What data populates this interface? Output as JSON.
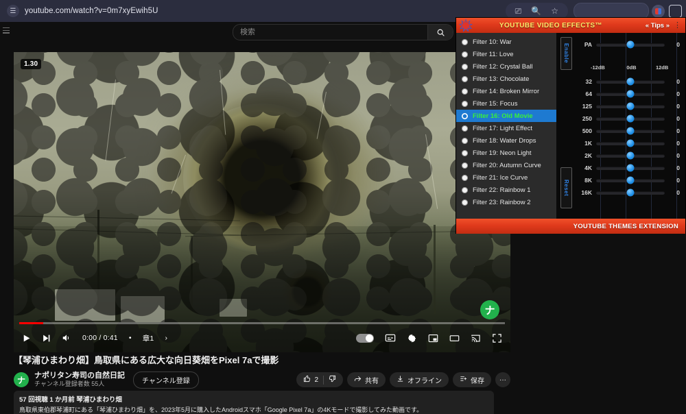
{
  "browser": {
    "url": "youtube.com/watch?v=0m7xyEwih5U",
    "url_badge_icon": "page-info-icon",
    "icons": [
      "cast-icon",
      "search-icon",
      "bookmark-star-icon"
    ],
    "extension_icon": "extension-puzzle-icon",
    "sidepanel_icon": "side-panel-icon"
  },
  "youtube": {
    "search": {
      "placeholder": "検索",
      "value": "",
      "button_icon": "search-icon"
    },
    "menu_icon": "hamburger-menu-icon",
    "player": {
      "speed_badge": "1.30",
      "channel_watermark": "ナ",
      "time": "0:00 / 0:41",
      "chapter": "章1",
      "chapter_arrow": "›",
      "play_icon": "play-icon",
      "next_icon": "next-video-icon",
      "volume_icon": "volume-icon",
      "autoplay_icon": "autoplay-toggle",
      "subtitles_icon": "subtitles-icon",
      "settings_icon": "gear-icon",
      "miniplayer_icon": "miniplayer-icon",
      "theater_icon": "theater-mode-icon",
      "cast_icon": "cast-icon",
      "fullscreen_icon": "fullscreen-icon"
    },
    "video": {
      "title": "【琴浦ひまわり畑】鳥取県にある広大な向日葵畑をPixel 7aで撮影",
      "channel_name": "ナポリタン寿司の自然日記",
      "channel_avatar_letter": "ナ",
      "subscriber_count": "チャンネル登録者数 55人",
      "subscribe_label": "チャンネル登録",
      "like_count": "2",
      "like_icon": "thumbs-up-icon",
      "dislike_icon": "thumbs-down-icon",
      "share_label": "共有",
      "share_icon": "share-icon",
      "offline_label": "オフライン",
      "offline_icon": "download-icon",
      "save_label": "保存",
      "save_icon": "playlist-add-icon",
      "more_label": "···"
    },
    "description": {
      "meta": "57 回視聴  1 か月前  琴浦ひまわり畑",
      "body": "鳥取県東伯郡琴浦町にある「琴浦ひまわり畑」を、2023年5月に購入したAndroidスマホ「Google Pixel 7a」の4Kモードで撮影してみた動画です。"
    }
  },
  "extension": {
    "title": "YOUTUBE VIDEO EFFECTS™",
    "tips_label": "« Tips »",
    "kebab_label": "⋮",
    "logo_icon": "splat-logo-icon",
    "footer_label": "YOUTUBE THEMES EXTENSION",
    "accent_color": "#e03a1c",
    "selected_color": "#1e7ad1",
    "selected_text_color": "#3af03a",
    "filters": [
      {
        "label": "Filter 10: War",
        "selected": false
      },
      {
        "label": "Filter 11: Love",
        "selected": false
      },
      {
        "label": "Filter 12: Crystal Ball",
        "selected": false
      },
      {
        "label": "Filter 13: Chocolate",
        "selected": false
      },
      {
        "label": "Filter 14: Broken Mirror",
        "selected": false
      },
      {
        "label": "Filter 15: Focus",
        "selected": false
      },
      {
        "label": "Filter 16: Old Movie",
        "selected": true
      },
      {
        "label": "Filter 17: Light Effect",
        "selected": false
      },
      {
        "label": "Filter 18: Water Drops",
        "selected": false
      },
      {
        "label": "Filter 19: Neon Light",
        "selected": false
      },
      {
        "label": "Filter 20: Autumn Curve",
        "selected": false
      },
      {
        "label": "Filter 21: Ice Curve",
        "selected": false
      },
      {
        "label": "Filter 22: Rainbow 1",
        "selected": false
      },
      {
        "label": "Filter 23: Rainbow 2",
        "selected": false
      }
    ],
    "equalizer": {
      "enable_label": "Enable",
      "reset_label": "Reset",
      "preamp": {
        "label": "PA",
        "value": "0",
        "position": 50
      },
      "scale": [
        "-12dB",
        "0dB",
        "12dB"
      ],
      "bands": [
        {
          "label": "32",
          "value": "0",
          "position": 50
        },
        {
          "label": "64",
          "value": "0",
          "position": 50
        },
        {
          "label": "125",
          "value": "0",
          "position": 50
        },
        {
          "label": "250",
          "value": "0",
          "position": 50
        },
        {
          "label": "500",
          "value": "0",
          "position": 50
        },
        {
          "label": "1K",
          "value": "0",
          "position": 50
        },
        {
          "label": "2K",
          "value": "0",
          "position": 50
        },
        {
          "label": "4K",
          "value": "0",
          "position": 50
        },
        {
          "label": "8K",
          "value": "0",
          "position": 50
        },
        {
          "label": "16K",
          "value": "0",
          "position": 50
        }
      ]
    }
  }
}
